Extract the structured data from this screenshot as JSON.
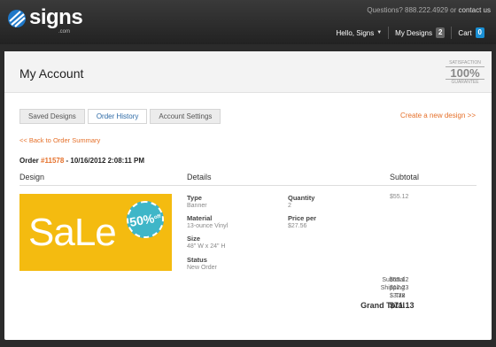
{
  "header": {
    "logo_text": "signs",
    "logo_sub": ".com",
    "questions_prefix": "Questions? 888.222.4929 or",
    "contact_link": "contact us",
    "nav": {
      "greeting": "Hello, Signs",
      "my_designs": "My Designs",
      "my_designs_count": "2",
      "cart": "Cart",
      "cart_count": "0"
    }
  },
  "account": {
    "title": "My Account",
    "guarantee": {
      "top": "SATISFACTION",
      "mid": "100%",
      "bottom": "GUARANTEE"
    },
    "tabs": [
      {
        "label": "Saved Designs",
        "active": false
      },
      {
        "label": "Order History",
        "active": true
      },
      {
        "label": "Account Settings",
        "active": false
      }
    ],
    "create_link": "Create a new design >>",
    "back_link": "<< Back to Order Summary"
  },
  "order": {
    "prefix": "Order",
    "number": "#11578",
    "date": " - 10/16/2012 2:08:11 PM",
    "columns": {
      "design": "Design",
      "details": "Details",
      "subtotal": "Subtotal"
    },
    "design_image": {
      "text": "SaLe",
      "sticker_pct": "50%",
      "sticker_off": "off"
    },
    "details": {
      "type_label": "Type",
      "type_value": "Banner",
      "material_label": "Material",
      "material_value": "13-ounce Vinyl",
      "size_label": "Size",
      "size_value": "48\" W x 24\" H",
      "status_label": "Status",
      "status_value": "New Order",
      "quantity_label": "Quantity",
      "quantity_value": "2",
      "price_label": "Price per",
      "price_value": "$27.56"
    },
    "line_subtotal": "$55.12",
    "summary": {
      "subtotal_label": "Subtotal",
      "subtotal": "$55.12",
      "shipping_label": "Shipping",
      "shipping": "$12.23",
      "tax_label": "Tax",
      "tax": "$3.78",
      "grand_total_label": "Grand Total",
      "grand_total": "$71.13"
    }
  },
  "colors": {
    "accent_orange": "#e5702a",
    "tab_blue": "#2d6aa6",
    "sale_yellow": "#f4bb10",
    "sticker_teal": "#3fb6c8"
  }
}
